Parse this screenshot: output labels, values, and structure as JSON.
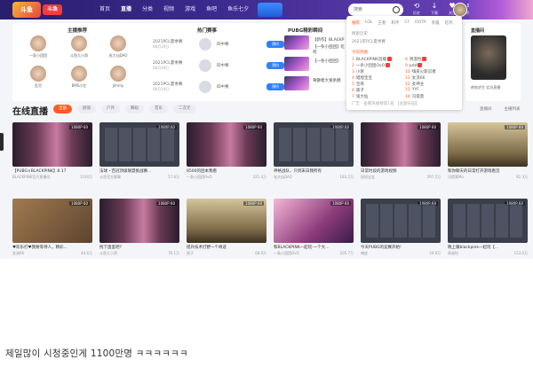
{
  "header": {
    "logo_text": "斗鱼",
    "logo_badge": "斗鱼",
    "nav": [
      "首页",
      "直播",
      "分类",
      "视频",
      "游戏",
      "鱼吧",
      "鱼乐七夕"
    ],
    "active_nav": 1,
    "search_placeholder": "搜索",
    "icons": [
      {
        "name": "history-icon",
        "glyph": "⟲",
        "label": "历史"
      },
      {
        "name": "download-icon",
        "glyph": "↓",
        "label": "下载"
      },
      {
        "name": "follow-icon",
        "glyph": "♥",
        "label": "关注"
      },
      {
        "name": "message-icon",
        "glyph": "✉",
        "label": "消息"
      }
    ]
  },
  "recommend": {
    "anchors_title": "主播推荐",
    "anchors": [
      {
        "name": "一条小团团"
      },
      {
        "name": "斗鱼九小哥"
      },
      {
        "name": "张大仙DAO"
      },
      {
        "name": "乱世"
      },
      {
        "name": "BMS小忆"
      },
      {
        "name": "Jimmy"
      }
    ],
    "matches_title": "热门赛事",
    "matches": [
      {
        "time": "2021PCL夏季赛",
        "date": "08月19日",
        "team": "四中赛",
        "button": "预约"
      },
      {
        "time": "2021PCL夏季赛",
        "date": "08月19日",
        "team": "四中赛",
        "button": "预约"
      },
      {
        "time": "2021PCL夏季赛",
        "date": "08月19日",
        "team": "四中赛",
        "button": "预约"
      }
    ],
    "pubg_title": "PUBG精彩瞬间",
    "pubg_lines": [
      "【新作】BLACKP",
      "【一条小团团】吃鸡",
      "【一条小团团】",
      "骨颤者大发杀戮"
    ]
  },
  "search_dropdown": {
    "tabs": [
      "推荐",
      "LOL",
      "王者",
      "和平",
      "CF",
      "DOTA",
      "英雄",
      "吃鸡"
    ],
    "history_head": "搜索历史",
    "history_item": "2021年PCL夏季赛",
    "hot_head": "今日热搜",
    "hot_left": [
      "BLACKPINK首播",
      "一条小团团OvO",
      "小葱",
      "旭旭宝宝",
      "宝哥",
      "寅子",
      "张大仙"
    ],
    "hot_right": [
      "周淑怡",
      "pdd",
      "嗨皮火影忍者",
      "女流66",
      "女神主",
      "YYF",
      "冯提莫"
    ],
    "footer": "广告 · 查看热搜榜第1名 【主题乐园】"
  },
  "side_card": {
    "title": "直播间",
    "caption": "绝地求生 实况直播"
  },
  "live": {
    "title": "在线直播",
    "filters": [
      "全部",
      "颜值",
      "户外",
      "舞蹈",
      "音乐",
      "二次元"
    ],
    "active_filter": 0,
    "view_options": [
      "直播间",
      "主播列表"
    ]
  },
  "cards": [
    {
      "style": "stage",
      "badge": "1080P 60",
      "title": "【PUBG×BLACKPINK】8.17",
      "host": "BLACKPINK官方直播间",
      "heat": "1100万"
    },
    {
      "style": "grid",
      "badge": "1080P 60",
      "title": "法球・百冠顶级联盟挑战赛...",
      "host": "斗鱼官方赛事",
      "heat": "57.6万"
    },
    {
      "style": "stage",
      "badge": "1080P 60",
      "title": "8500的团本我看",
      "host": "一条小团团OvO",
      "heat": "321.4万"
    },
    {
      "style": "grid",
      "badge": "1080P 60",
      "title": "神格战队，只到末日我所有",
      "host": "张大仙DAO",
      "heat": "183.2万"
    },
    {
      "style": "stage",
      "badge": "1080P 60",
      "title": "日常时段的游戏视频",
      "host": "旭旭宝宝",
      "heat": "297.5万"
    },
    {
      "style": "game",
      "badge": "1080P 60",
      "title": "和你聊天的日常打开游戏看见",
      "host": "冯提莫Mo",
      "heat": "92.3万"
    },
    {
      "style": "room",
      "badge": "1080P 60",
      "title": "♥欢乐打♥我要等待人，精彩...",
      "host": "女流66",
      "heat": "44.6万"
    },
    {
      "style": "stage",
      "badge": "1080P 60",
      "title": "找下蛋蛋吧?",
      "host": "斗鱼九小哥",
      "heat": "76.1万"
    },
    {
      "style": "game",
      "badge": "1080P 60",
      "title": "提升技术打野一个奇迹",
      "host": "寅子",
      "heat": "68.9万"
    },
    {
      "style": "pink",
      "badge": "1080P 60",
      "title": "和BLACKPINK一起玩·一个大...",
      "host": "一条小团团OvO",
      "heat": "205.7万"
    },
    {
      "style": "grid",
      "badge": "1080P 60",
      "title": "今天PUBG的竞赛开始!",
      "host": "嗨皮",
      "heat": "39.8万"
    },
    {
      "style": "grid",
      "badge": "1080P 60",
      "title": "晚上跟blackpink一起玩【...",
      "host": "周淑怡",
      "heat": "153.0万"
    }
  ],
  "caption": "제일많이 시청중인게 1100만명 ㅋㅋㅋㅋㅋㅋ"
}
